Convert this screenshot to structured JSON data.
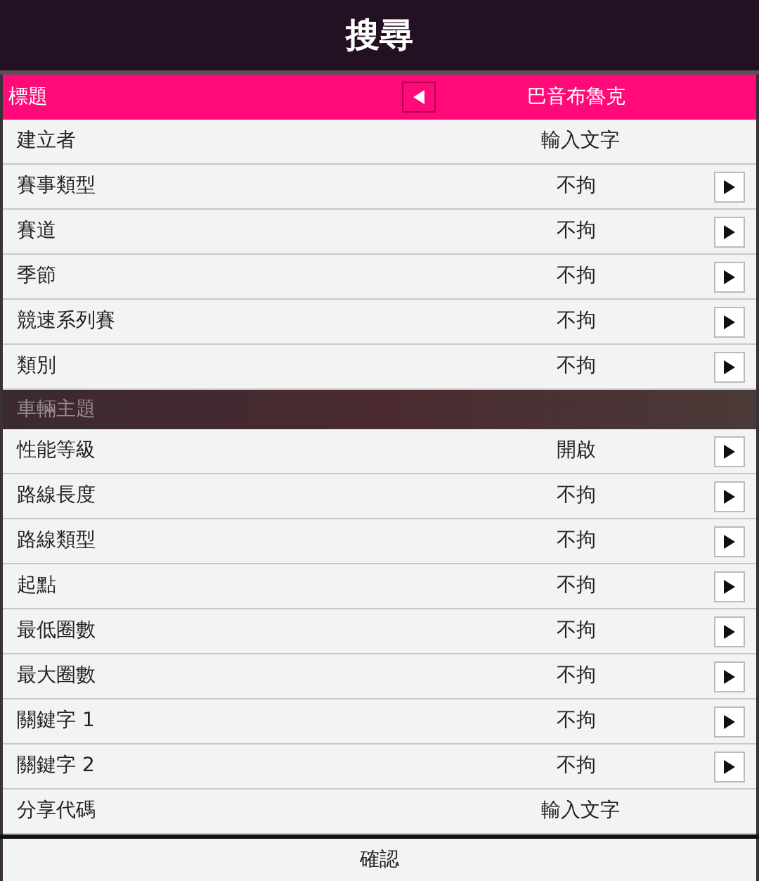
{
  "title": "搜尋",
  "title_row": {
    "label": "標題",
    "value": "巴音布魯克"
  },
  "rows": [
    {
      "label": "建立者",
      "value": "輸入文字",
      "kind": "input"
    },
    {
      "label": "賽事類型",
      "value": "不拘",
      "kind": "arrow"
    },
    {
      "label": "賽道",
      "value": "不拘",
      "kind": "arrow"
    },
    {
      "label": "季節",
      "value": "不拘",
      "kind": "arrow"
    },
    {
      "label": "競速系列賽",
      "value": "不拘",
      "kind": "arrow"
    },
    {
      "label": "類別",
      "value": "不拘",
      "kind": "arrow"
    }
  ],
  "section": {
    "label": "車輛主題",
    "rows": [
      {
        "label": "性能等級",
        "value": "開啟",
        "kind": "arrow"
      },
      {
        "label": "路線長度",
        "value": "不拘",
        "kind": "arrow"
      },
      {
        "label": "路線類型",
        "value": "不拘",
        "kind": "arrow"
      },
      {
        "label": "起點",
        "value": "不拘",
        "kind": "arrow"
      },
      {
        "label": "最低圈數",
        "value": "不拘",
        "kind": "arrow"
      },
      {
        "label": "最大圈數",
        "value": "不拘",
        "kind": "arrow"
      },
      {
        "label": "關鍵字 1",
        "value": "不拘",
        "kind": "arrow"
      },
      {
        "label": "關鍵字 2",
        "value": "不拘",
        "kind": "arrow"
      },
      {
        "label": "分享代碼",
        "value": "輸入文字",
        "kind": "input"
      }
    ]
  },
  "confirm_button": "確認"
}
